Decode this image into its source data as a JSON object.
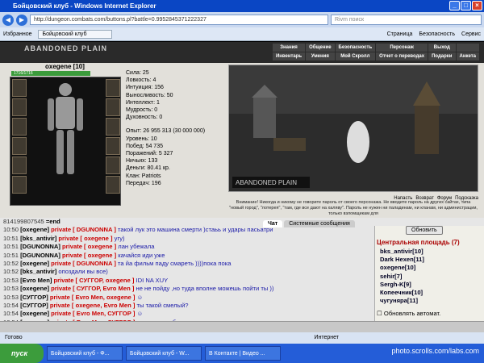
{
  "window": {
    "title": "Бойцовский клуб - Windows Internet Explorer"
  },
  "address": {
    "url": "http://dungeon.combats.com/buttons.pl?battle=0.9952845371222327",
    "search_placeholder": "Rivm поиск"
  },
  "favbar": {
    "favorites": "Избранное",
    "tab": "Бойцовский клуб",
    "page": "Страница",
    "security": "Безопасность",
    "service": "Сервис"
  },
  "game": {
    "logo": "ABANDONED PLAIN",
    "menu": [
      "Знания",
      "Общение",
      "Безопасность",
      "Персонаж",
      "Выход",
      "Инвентарь",
      "Умения",
      "Мой Скролл",
      "Отчет о переводах",
      "Подарки",
      "Анкета"
    ]
  },
  "character": {
    "name": "oxegene [10]",
    "hp": "1716/1716",
    "stats": [
      "Сила: 25",
      "Ловкость: 4",
      "Интуиция: 156",
      "Выносливость: 50",
      "Интеллект: 1",
      "Мудрость: 0",
      "Духовность: 0"
    ],
    "info": [
      "Опыт: 26 955 313 (30 000 000)",
      "Уровень: 10",
      "Побед: 54 735",
      "Поражений: 5 327",
      "Ничьих: 133",
      "Деньги: 80.41 кр.",
      "Клан: Patriots",
      "Передач: 196"
    ]
  },
  "scene": {
    "label": "ABANDONED PLAIN",
    "links": [
      "Напасть",
      "Возврат",
      "Форум",
      "Подсказка"
    ]
  },
  "warning": "Внимание! Никогда и никому не говорите пароль от своего персонажа. Не вводите пароль на других сайтах, типа \"новый город\", \"лотерея\", \"там, где все дают на халяву\". Пароль не нужен ни паладинам, ни кланам, ни администрации, только взломщикам для",
  "chat": {
    "tabs": [
      "Чат",
      "Системные сообщения"
    ],
    "lines": [
      {
        "time": "814199807545",
        "nick": "=end",
        "priv": "",
        "msg": ""
      },
      {
        "time": "10:50",
        "nick": "[oxegene]",
        "priv": "private [ DGUNONNA ]",
        "msg": "такой лук это машина смерти )стаьь и удары пасьатри"
      },
      {
        "time": "10:51",
        "nick": "[bks_antivir]",
        "priv": "private [ oxegene ]",
        "msg": "угу)"
      },
      {
        "time": "10:51",
        "nick": "[DGUNONNA]",
        "priv": "private [ oxegene ]",
        "msg": "лан убежала"
      },
      {
        "time": "10:51",
        "nick": "[DGUNONNA]",
        "priv": "private [ oxegene ]",
        "msg": "качайся иди уже"
      },
      {
        "time": "10:52",
        "nick": "[oxegene]",
        "priv": "private [ DGUNONNA ]",
        "msg": "та йа фильм паду смареть ))))пока пока"
      },
      {
        "time": "10:52",
        "nick": "[bks_antivir]",
        "priv": "",
        "msg": "опоздали вы все)"
      },
      {
        "time": "10:53",
        "nick": "[Evro Men]",
        "priv": "private [ СУГГОР, oxegene ]",
        "msg": "IDI NA XUY"
      },
      {
        "time": "10:53",
        "nick": "[oxegene]",
        "priv": "private [ СУГГОР, Evro Men ]",
        "msg": "не не пойду ,но туда вполне можешь пойти ты ))"
      },
      {
        "time": "10:53",
        "nick": "[СУГГОР]",
        "priv": "private [ Evro Men, oxegene ]",
        "msg": "☺"
      },
      {
        "time": "10:54",
        "nick": "[СУГГОР]",
        "priv": "private [ oxegene, Evro Men ]",
        "msg": "ты такой смелый?"
      },
      {
        "time": "10:54",
        "nick": "[oxegene]",
        "priv": "private [ Evro Men, СУГГОР ]",
        "msg": "☺"
      },
      {
        "time": "10:54",
        "nick": "[oxegene]",
        "priv": "private [ Evro Men, СУГГОР ]",
        "msg": "хамов не люблю"
      }
    ],
    "update_btn": "Обновить",
    "room": "Центральная площадь (7)",
    "users": [
      "bks_antivir[10]",
      "Dark Hexen[11]",
      "oxegene[10]",
      "sehir[7]",
      "Sergh-K[9]",
      "Копеечник[10]",
      "чугуняра[11]"
    ],
    "auto_update": "Обновлять автомат."
  },
  "status": {
    "text": "Готово",
    "zone": "Интернет",
    "zoom": "100%"
  },
  "taskbar": {
    "start": "пуск",
    "tasks": [
      "Бойцовский клуб - Ф...",
      "Бойцовский клуб - W...",
      "В Контакте | Видео ..."
    ],
    "clock": "10:54",
    "watermark": "photo.scrolls.com/labs.com"
  }
}
